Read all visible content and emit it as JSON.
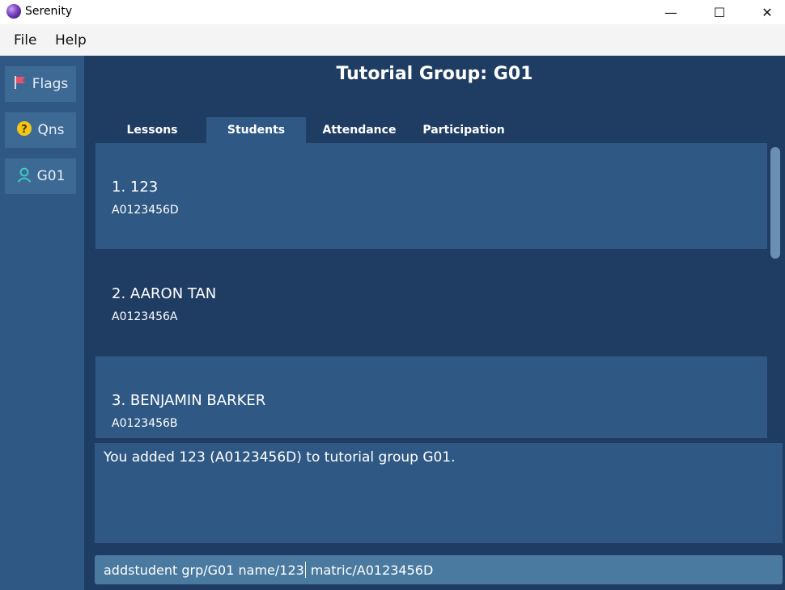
{
  "window": {
    "title": "Serenity",
    "minimize_glyph": "—",
    "maximize_glyph": "☐",
    "close_glyph": "✕"
  },
  "menu": {
    "file": "File",
    "help": "Help"
  },
  "sidebar": {
    "items": [
      {
        "label": "Flags",
        "icon": "flag-icon"
      },
      {
        "label": "Qns",
        "icon": "question-icon"
      },
      {
        "label": "G01",
        "icon": "user-icon"
      }
    ]
  },
  "main": {
    "title": "Tutorial Group: G01",
    "tabs": [
      {
        "label": "Lessons"
      },
      {
        "label": "Students",
        "selected": true
      },
      {
        "label": "Attendance"
      },
      {
        "label": "Participation"
      }
    ],
    "students": [
      {
        "name": "1.  123",
        "matric": "A0123456D"
      },
      {
        "name": "2.  AARON TAN",
        "matric": "A0123456A"
      },
      {
        "name": "3.  BENJAMIN BARKER",
        "matric": "A0123456B"
      }
    ]
  },
  "result": {
    "message": "You added 123 (A0123456D) to tutorial group G01."
  },
  "command": {
    "before_caret": "addstudent grp/G01 name/123",
    "after_caret": " matric/A0123456D"
  },
  "colors": {
    "sidebar_bg": "#2f5984",
    "main_bg": "#1f3d63",
    "card_light": "#2f5984",
    "command_bg": "#4a7aa0"
  }
}
